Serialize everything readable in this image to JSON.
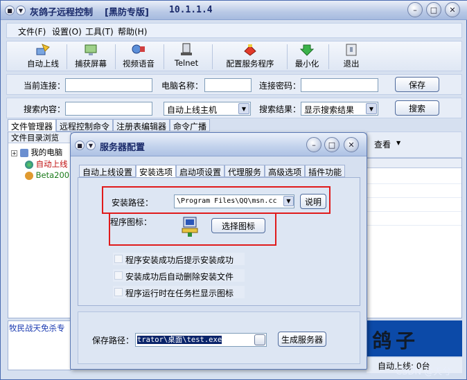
{
  "main": {
    "title": "灰鸽子远程控制",
    "edition": "[黑防专版]",
    "version": "10.1.1.4",
    "controls": {
      "minimize": "–",
      "maximize": "□",
      "close": "✕"
    }
  },
  "menu": [
    "文件(F)",
    "设置(O)",
    "工具(T)",
    "帮助(H)"
  ],
  "toolbar": [
    {
      "label": "自动上线",
      "icon": "auto-online-icon"
    },
    {
      "label": "捕获屏幕",
      "icon": "capture-screen-icon"
    },
    {
      "label": "视频语音",
      "icon": "video-voice-icon"
    },
    {
      "label": "Telnet",
      "icon": "telnet-icon"
    },
    {
      "label": "配置服务程序",
      "icon": "configure-service-icon"
    },
    {
      "label": "最小化",
      "icon": "minimize-icon"
    },
    {
      "label": "退出",
      "icon": "exit-icon"
    }
  ],
  "connection": {
    "current_label": "当前连接：",
    "current_value": "",
    "computer_label": "电脑名称：",
    "computer_value": "",
    "password_label": "连接密码：",
    "password_value": "",
    "save": "保存"
  },
  "search": {
    "content_label": "搜索内容：",
    "content_value": "",
    "scope": "自动上线主机",
    "result_label": "搜索结果：",
    "result_value": "显示搜索结果",
    "search_button": "搜索"
  },
  "main_tabs": [
    "文件管理器",
    "远程控制命令",
    "注册表编辑器",
    "命令广播"
  ],
  "file_browser": {
    "header": "文件目录浏览",
    "items": [
      "我的电脑",
      "自动上线",
      "Beta200"
    ],
    "view": "查看"
  },
  "bottom": {
    "ad_text": "牧民战天免杀专",
    "logo_text": "鸽子",
    "status": "自动上线: 0台",
    "watermark": "CSDN @天兮"
  },
  "dialog": {
    "title": "服务器配置",
    "tabs": [
      "自动上线设置",
      "安装选项",
      "启动项设置",
      "代理服务",
      "高级选项",
      "插件功能"
    ],
    "install_path_label": "安装路径：",
    "install_path_value": "\\Program Files\\QQ\\msn.cc",
    "explain_button": "说明",
    "program_icon_label": "程序图标：",
    "choose_icon_button": "选择图标",
    "options": [
      "程序安装成功后提示安装成功",
      "安装成功后自动删除安装文件",
      "程序运行时在任务栏显示图标"
    ],
    "save_path_label": "保存路径：",
    "save_path_value": "trator\\桌面\\test.exe",
    "generate_button": "生成服务器"
  },
  "colors": {
    "highlight_border": "#e01a1a",
    "selection": "#0a246a",
    "title_text": "#1a2a6a"
  }
}
